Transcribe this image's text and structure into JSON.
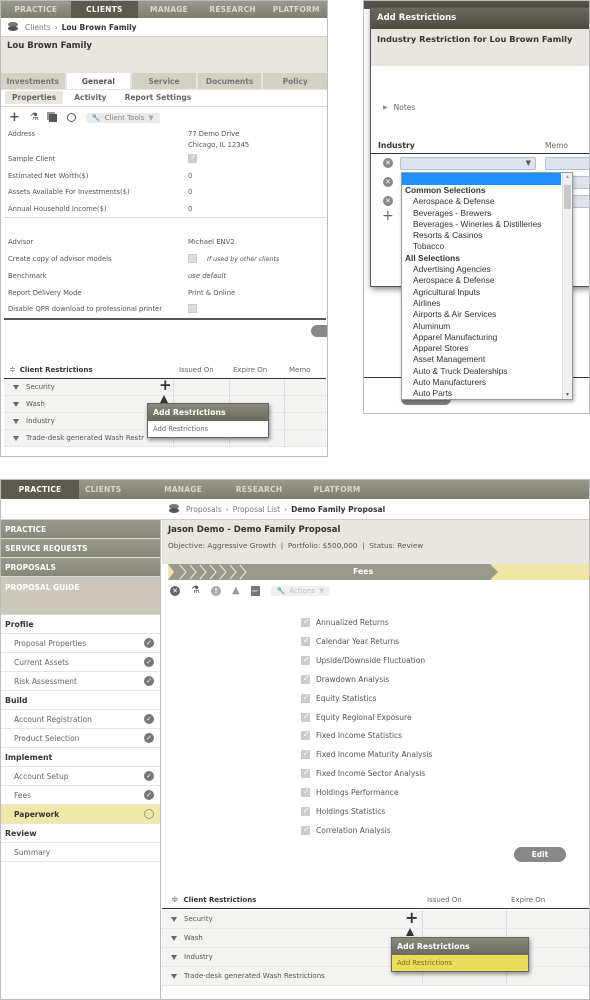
{
  "panel1": {
    "nav": [
      "PRACTICE",
      "CLIENTS",
      "MANAGE",
      "RESEARCH",
      "PLATFORM"
    ],
    "nav_active": 1,
    "breadcrumb": {
      "parent": "Clients",
      "current": "Lou Brown Family"
    },
    "title": "Lou Brown Family",
    "tabs": [
      "Investments",
      "General",
      "Service",
      "Documents",
      "Policy"
    ],
    "tab_active": 1,
    "subtabs": [
      "Properties",
      "Activity",
      "Report Settings"
    ],
    "toolbar": {
      "client_tools": "Client Tools"
    },
    "properties": [
      {
        "label": "Address",
        "value": "77 Demo Drive",
        "value2": "Chicago, IL 12345"
      },
      {
        "label": "Sample Client",
        "type": "checkbox",
        "checked": true
      },
      {
        "label": "Estimated Net Worth($)",
        "value": "0"
      },
      {
        "label": "Assets Available For Investments($)",
        "value": "0"
      },
      {
        "label": "Annual Household Income($)",
        "value": "0"
      },
      {
        "label": "Advisor",
        "value": "Michael ENV2"
      },
      {
        "label": "Create copy of advisor models",
        "type": "checkbox",
        "checked": false,
        "note": "If used by other clients"
      },
      {
        "label": "Benchmark",
        "value": "use default"
      },
      {
        "label": "Report Delivery Mode",
        "value": "Print & Online"
      },
      {
        "label": "Disable QPR download to professional printer",
        "type": "checkbox",
        "checked": false
      }
    ],
    "restrictions": {
      "title": "Client Restrictions",
      "columns": [
        "Issued On",
        "Expire On",
        "Memo"
      ],
      "rows": [
        "Security",
        "Wash",
        "Industry",
        "Trade-desk generated Wash Restr"
      ]
    },
    "popup": {
      "title": "Add Restrictions",
      "item": "Add Restrictions"
    }
  },
  "panel2": {
    "modal_title": "Add Restrictions",
    "subtitle": "Industry Restriction for Lou Brown Family",
    "notes_label": "Notes",
    "col_industry": "Industry",
    "col_memo": "Memo",
    "dropdown": {
      "group1": "Common Selections",
      "common": [
        "Aerospace & Defense",
        "Beverages - Brewers",
        "Beverages - Wineries & Distilleries",
        "Resorts & Casinos",
        "Tobacco"
      ],
      "group2": "All Selections",
      "all": [
        "Advertising Agencies",
        "Aerospace & Defense",
        "Agricultural Inputs",
        "Airlines",
        "Airports & Air Services",
        "Aluminum",
        "Apparel Manufacturing",
        "Apparel Stores",
        "Asset Management",
        "Auto & Truck Dealerships",
        "Auto Manufacturers",
        "Auto Parts"
      ]
    }
  },
  "panel3": {
    "nav": [
      "PRACTICE",
      "CLIENTS",
      "MANAGE",
      "RESEARCH",
      "PLATFORM"
    ],
    "nav_active": 0,
    "breadcrumb": [
      "Proposals",
      "Proposal List",
      "Demo Family Proposal"
    ],
    "sidebar": {
      "heads": [
        "PRACTICE",
        "SERVICE REQUESTS",
        "PROPOSALS",
        "PROPOSAL GUIDE"
      ],
      "groups": [
        {
          "name": "Profile",
          "items": [
            {
              "label": "Proposal Properties",
              "done": true
            },
            {
              "label": "Current Assets",
              "done": true
            },
            {
              "label": "Risk Assessment",
              "done": true
            }
          ]
        },
        {
          "name": "Build",
          "items": [
            {
              "label": "Account Registration",
              "done": true
            },
            {
              "label": "Product Selection",
              "done": true
            }
          ]
        },
        {
          "name": "Implement",
          "items": [
            {
              "label": "Account Setup",
              "done": true
            },
            {
              "label": "Fees",
              "done": true
            },
            {
              "label": "Paperwork",
              "done": false,
              "active": true
            }
          ]
        },
        {
          "name": "Review",
          "items": [
            {
              "label": "Summary",
              "done": false
            }
          ]
        }
      ]
    },
    "title": "Jason Demo - Demo Family Proposal",
    "summary": "Objective: Aggressive Growth  |  Portfolio: $500,000  |  Status: Review",
    "progress_step": "Fees",
    "actions_label": "Actions",
    "report_items": [
      "Annualized Returns",
      "Calendar Year Returns",
      "Upside/Downside Fluctuation",
      "Drawdown Analysis",
      "Equity Statistics",
      "Equity Regional Exposure",
      "Fixed Income Statistics",
      "Fixed Income Maturity Analysis",
      "Fixed Income Sector Analysis",
      "Holdings Performance",
      "Holdings Statistics",
      "Correlation Analysis"
    ],
    "edit_label": "Edit",
    "restrictions": {
      "title": "Client Restrictions",
      "columns": [
        "Issued On",
        "Expire On"
      ],
      "rows": [
        "Security",
        "Wash",
        "Industry",
        "Trade-desk generated Wash Restrictions"
      ]
    },
    "popup": {
      "title": "Add Restrictions",
      "item": "Add Restrictions",
      "highlight": "#e8dc5a"
    }
  }
}
